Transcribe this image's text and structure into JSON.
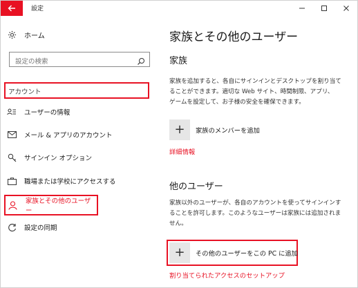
{
  "window": {
    "title": "設定",
    "controls": [
      "minimize-icon",
      "maximize-icon",
      "close-icon"
    ]
  },
  "sidebar": {
    "home_label": "ホーム",
    "search_placeholder": "設定の検索",
    "category_label": "アカウント",
    "items": [
      {
        "label": "ユーザーの情報",
        "icon": "user-info-icon"
      },
      {
        "label": "メール & アプリのアカウント",
        "icon": "mail-icon"
      },
      {
        "label": "サインイン オプション",
        "icon": "key-icon"
      },
      {
        "label": "職場または学校にアクセスする",
        "icon": "briefcase-icon"
      },
      {
        "label": "家族とその他のユーザー",
        "icon": "person-icon",
        "selected": true
      },
      {
        "label": "設定の同期",
        "icon": "sync-icon"
      }
    ]
  },
  "main": {
    "title": "家族とその他のユーザー",
    "family": {
      "heading": "家族",
      "description_lines": [
        "家族を追加すると、各自にサインインとデスクトップを割り当て",
        "ることができます。適切な Web サイト、時間制限、アプリ、",
        "ゲームを設定して、お子様の安全を確保できます。"
      ],
      "add_label": "家族のメンバーを追加",
      "more_info_link": "詳細情報"
    },
    "others": {
      "heading": "他のユーザー",
      "description_lines": [
        "家族以外のユーザーが、各自のアカウントを使ってサインインす",
        "ることを許可します。このようなユーザーは家族には追加されま",
        "せん。"
      ],
      "add_label": "その他のユーザーをこの PC に追加",
      "assigned_access_link": "割り当てられたアクセスのセットアップ"
    }
  },
  "colors": {
    "accent": "#e81123",
    "highlight_border": "#e81123",
    "plus_tile": "#e6e6e6"
  }
}
